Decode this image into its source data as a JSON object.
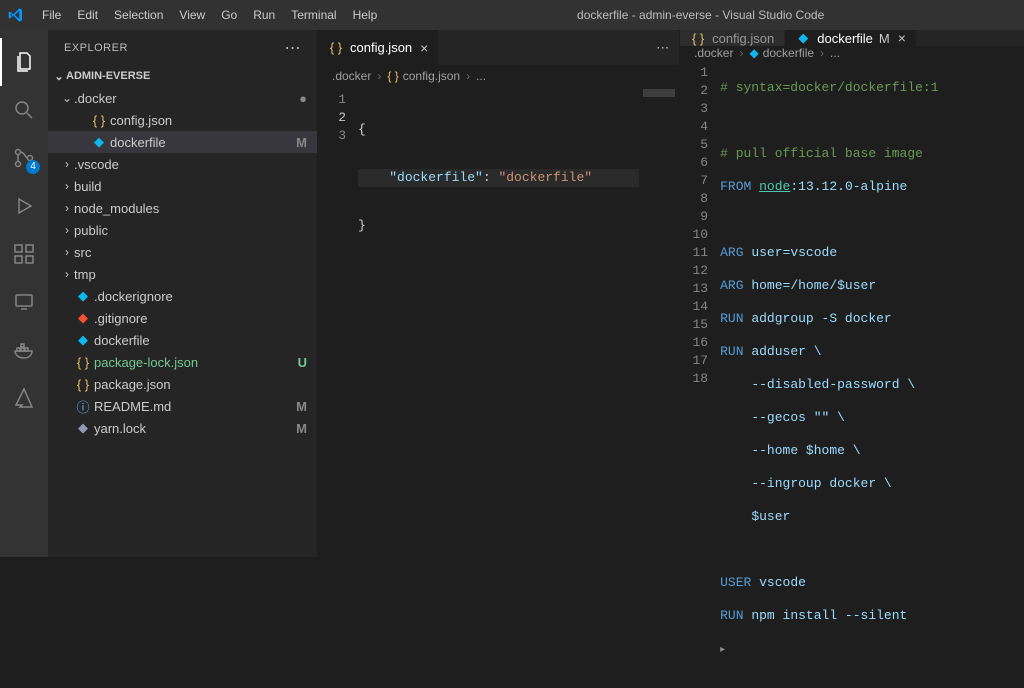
{
  "titlebar": {
    "menu": [
      "File",
      "Edit",
      "Selection",
      "View",
      "Go",
      "Run",
      "Terminal",
      "Help"
    ],
    "title": "dockerfile - admin-everse - Visual Studio Code"
  },
  "activitybar": {
    "scm_badge": "4"
  },
  "sidebar": {
    "title": "EXPLORER",
    "project": "ADMIN-EVERSE",
    "tree": [
      {
        "type": "folder",
        "name": ".docker",
        "expanded": true,
        "indent": 1,
        "status": "●"
      },
      {
        "type": "file",
        "name": "config.json",
        "icon": "json",
        "indent": 2
      },
      {
        "type": "file",
        "name": "dockerfile",
        "icon": "docker",
        "indent": 2,
        "status": "M",
        "selected": true
      },
      {
        "type": "folder",
        "name": ".vscode",
        "expanded": false,
        "indent": 1
      },
      {
        "type": "folder",
        "name": "build",
        "expanded": false,
        "indent": 1
      },
      {
        "type": "folder",
        "name": "node_modules",
        "expanded": false,
        "indent": 1
      },
      {
        "type": "folder",
        "name": "public",
        "expanded": false,
        "indent": 1
      },
      {
        "type": "folder",
        "name": "src",
        "expanded": false,
        "indent": 1
      },
      {
        "type": "folder",
        "name": "tmp",
        "expanded": false,
        "indent": 1
      },
      {
        "type": "file",
        "name": ".dockerignore",
        "icon": "docker",
        "indent": 1
      },
      {
        "type": "file",
        "name": ".gitignore",
        "icon": "git",
        "indent": 1
      },
      {
        "type": "file",
        "name": "dockerfile",
        "icon": "docker",
        "indent": 1
      },
      {
        "type": "file",
        "name": "package-lock.json",
        "icon": "json",
        "indent": 1,
        "status": "U",
        "untracked": true
      },
      {
        "type": "file",
        "name": "package.json",
        "icon": "json",
        "indent": 1
      },
      {
        "type": "file",
        "name": "README.md",
        "icon": "readme",
        "indent": 1,
        "status": "M"
      },
      {
        "type": "file",
        "name": "yarn.lock",
        "icon": "yarn",
        "indent": 1,
        "status": "M"
      }
    ]
  },
  "editor_left": {
    "tab_label": "config.json",
    "breadcrumbs": [
      ".docker",
      "config.json",
      "..."
    ],
    "lines": [
      "1",
      "2",
      "3"
    ],
    "code_highlight_line": 2,
    "json": {
      "key": "\"dockerfile\"",
      "value": "\"dockerfile\""
    }
  },
  "editor_right": {
    "tabs": [
      {
        "label": "config.json",
        "icon": "json",
        "active": false
      },
      {
        "label": "dockerfile",
        "icon": "docker",
        "active": true,
        "modified": "M"
      }
    ],
    "breadcrumbs": [
      ".docker",
      "dockerfile",
      "..."
    ],
    "lines": [
      "1",
      "2",
      "3",
      "4",
      "5",
      "6",
      "7",
      "8",
      "9",
      "10",
      "11",
      "12",
      "13",
      "14",
      "15",
      "16",
      "17",
      "18"
    ],
    "code": {
      "l1": "# syntax=docker/dockerfile:1",
      "l3": "# pull official base image",
      "l4_kw": "FROM",
      "l4_node": "node",
      "l4_rest": ":13.12.0-alpine",
      "l6_kw": "ARG",
      "l6": "user=vscode",
      "l7_kw": "ARG",
      "l7": "home=/home/$user",
      "l8_kw": "RUN",
      "l8": "addgroup -S docker",
      "l9_kw": "RUN",
      "l9": "adduser \\",
      "l10": "--disabled-password \\",
      "l11": "--gecos \"\" \\",
      "l12": "--home $home \\",
      "l13": "--ingroup docker \\",
      "l14": "$user",
      "l16_kw": "USER",
      "l16": "vscode",
      "l17_kw": "RUN",
      "l17": "npm install --silent"
    }
  }
}
